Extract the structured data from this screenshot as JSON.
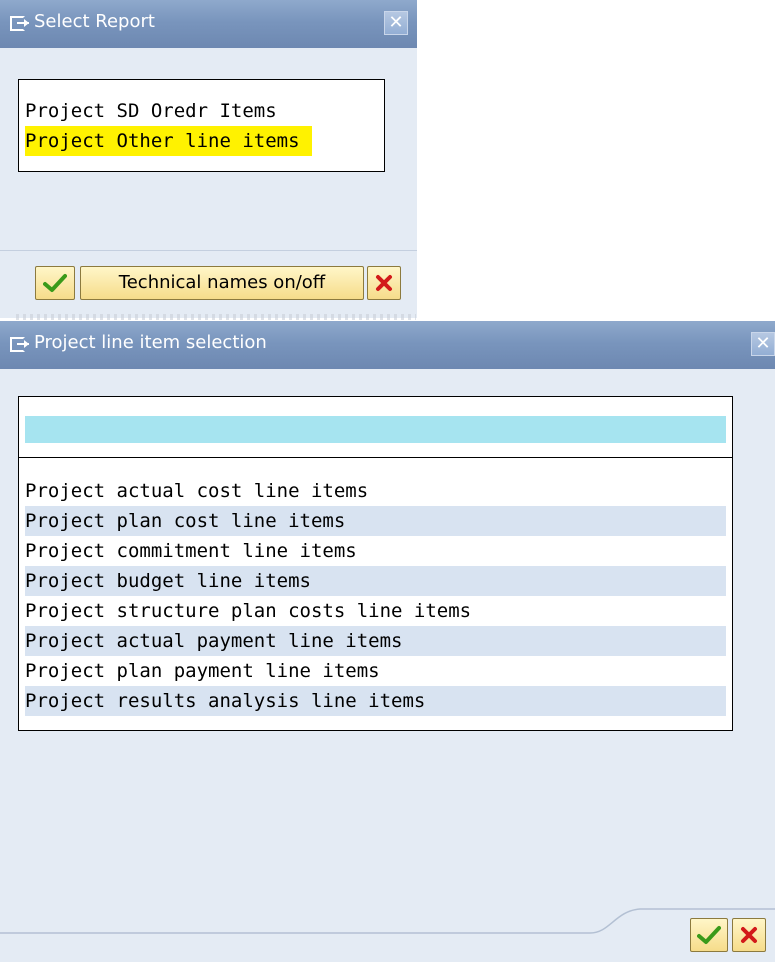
{
  "select_report": {
    "title": "Select Report",
    "close_glyph": "✕",
    "items": [
      {
        "label": "Project SD Oredr Items",
        "selected": false
      },
      {
        "label": "Project Other line items",
        "selected": true
      }
    ],
    "buttons": {
      "confirm_icon": "check-icon",
      "technical_names_label": "Technical names on/off",
      "cancel_icon": "x-icon"
    }
  },
  "line_item_selection": {
    "title": "Project line item selection",
    "close_glyph": "✕",
    "filter_value": "",
    "items": [
      "Project actual cost line items",
      "Project plan cost line items",
      "Project commitment line items",
      "Project budget line items",
      "Project structure plan costs line items",
      "Project actual payment line items",
      "Project plan payment line items",
      "Project results analysis line items"
    ],
    "buttons": {
      "confirm_icon": "check-icon",
      "cancel_icon": "x-icon"
    }
  },
  "colors": {
    "title_bar": "#7d98c0",
    "dialog_bg": "#e4ebf4",
    "row_alt": "#d8e3f1",
    "highlight": "#fff200",
    "filter_bar": "#a6e4f0",
    "button_bg": "#f6dc8a",
    "check": "#3a9a1a",
    "cancel": "#d21a1a"
  }
}
